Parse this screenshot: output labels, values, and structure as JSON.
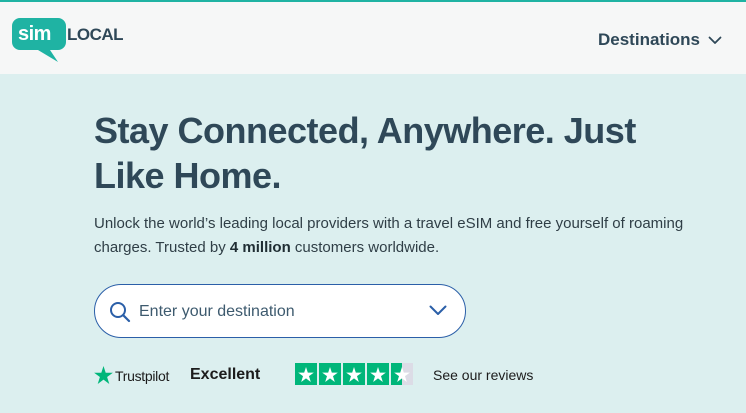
{
  "header": {
    "logo": {
      "part1": "sim",
      "part2": "LOCAL"
    },
    "nav_destinations_label": "Destinations"
  },
  "hero": {
    "headline": "Stay Connected, Anywhere.  Just Like Home.",
    "description_before": "Unlock the world’s leading local providers with a travel eSIM and free yourself of roaming charges. Trusted by ",
    "description_highlight": "4 million",
    "description_after": " customers worldwide.",
    "search": {
      "placeholder": "Enter your destination",
      "value": ""
    }
  },
  "trustpilot": {
    "brand": "Trustpilot",
    "rating_text": "Excellent",
    "stars": 4.5,
    "reviews_link": "See our reviews"
  },
  "colors": {
    "brand_teal": "#1fb3a3",
    "heading": "#2f4858",
    "hero_bg": "#dcefef",
    "search_border": "#2b5fa8",
    "trustpilot_green": "#00b67a"
  },
  "icons": {
    "nav": "chevron-down-icon",
    "search": "search-icon",
    "search_dropdown": "chevron-down-icon",
    "trustpilot": "star-icon"
  }
}
